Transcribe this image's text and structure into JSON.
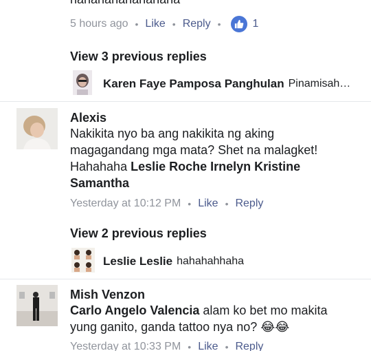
{
  "comment_top": {
    "text": "hahahahahahahaha",
    "time": "5 hours ago",
    "like_label": "Like",
    "reply_label": "Reply",
    "like_count": "1",
    "like_color": "#4a76d6"
  },
  "thread1": {
    "view_replies": "View 3 previous replies",
    "reply_name": "Karen Faye Pamposa Panghulan",
    "reply_text": "Pinamisah…"
  },
  "comment_alexis": {
    "name": "Alexis",
    "text_1": "Nakikita nyo ba ang nakikita ng aking magagandang mga mata? Shet na malagket! Hahahaha ",
    "tag_1": "Leslie Roche Irnelyn Kristine Samantha",
    "time": "Yesterday at 10:12 PM",
    "like_label": "Like",
    "reply_label": "Reply"
  },
  "thread2": {
    "view_replies": "View 2 previous replies",
    "reply_name": "Leslie Leslie",
    "reply_text": "hahahahhaha"
  },
  "comment_mish": {
    "name": "Mish Venzon",
    "tag_1": "Carlo Angelo Valencia",
    "text_1": " alam ko bet mo makita yung ganito, ganda tattoo nya no? 😂😂",
    "time": "Yesterday at 10:33 PM",
    "like_label": "Like",
    "reply_label": "Reply"
  }
}
